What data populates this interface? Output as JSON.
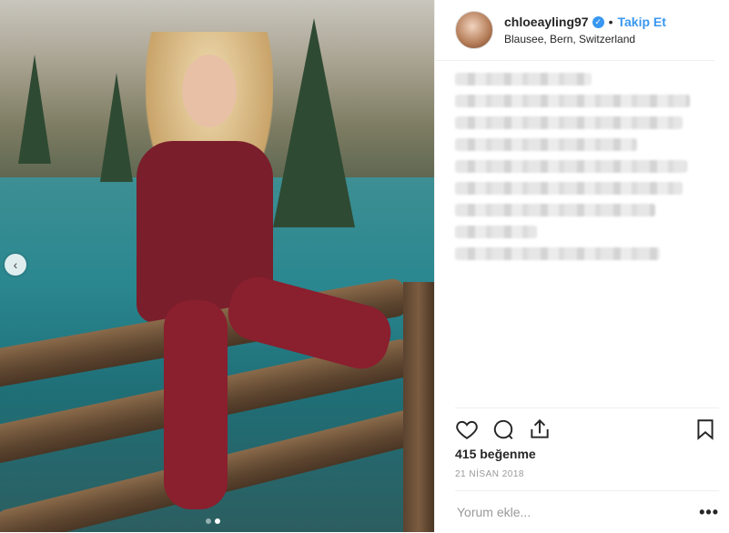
{
  "header": {
    "username": "chloeayling97",
    "separator": "•",
    "follow_label": "Takip Et",
    "location": "Blausee, Bern, Switzerland"
  },
  "carousel": {
    "prev_icon": "‹",
    "slide_count": 2,
    "active_index": 1
  },
  "engagement": {
    "likes": "415 beğenme",
    "date": "21 NİSAN 2018"
  },
  "comment": {
    "placeholder": "Yorum ekle...",
    "more_icon": "•••"
  },
  "colors": {
    "accent": "#3897f0",
    "text": "#262626",
    "muted": "#999999",
    "divider": "#efefef"
  },
  "icons": [
    "verified-badge-icon",
    "chevron-left-icon",
    "heart-icon",
    "comment-icon",
    "share-icon",
    "bookmark-icon",
    "more-options-icon"
  ]
}
